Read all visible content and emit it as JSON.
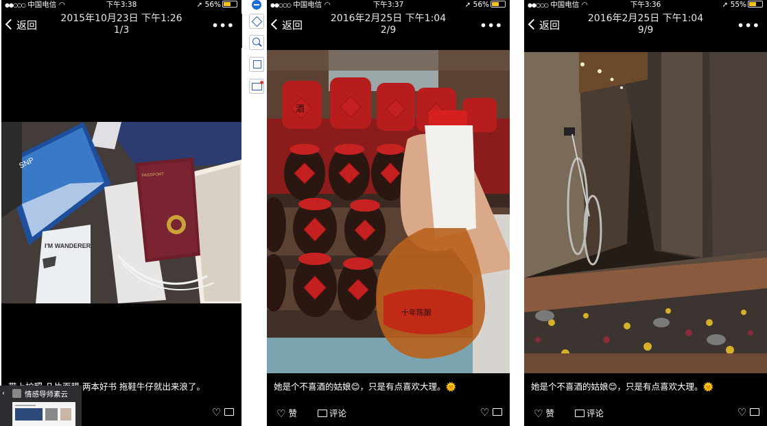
{
  "panels": [
    {
      "status": {
        "carrier": "中国电信",
        "time": "下午3:38",
        "battery": "56%"
      },
      "nav": {
        "back": "返回",
        "date": "2015年10月23日 下午1:26",
        "count": "1/3"
      },
      "caption": "带上护照 几片面膜 两本好书 拖鞋牛仔就出来浪了。",
      "actions": {}
    },
    {
      "status": {
        "carrier": "中国电信",
        "time": "下午3:37",
        "battery": "56%"
      },
      "nav": {
        "back": "返回",
        "date": "2016年2月25日 下午1:04",
        "count": "2/9"
      },
      "caption": "她是个不喜酒的姑娘😊，只是有点喜欢大理。🌞",
      "actions": {
        "like": "赞",
        "comment": "评论"
      }
    },
    {
      "status": {
        "carrier": "中国电信",
        "time": "下午3:36",
        "battery": "55%"
      },
      "nav": {
        "back": "返回",
        "date": "2016年2月25日 下午1:04",
        "count": "9/9"
      },
      "caption": "她是个不喜酒的姑娘😊，只是有点喜欢大理。🌞",
      "actions": {
        "like": "赞",
        "comment": "评论"
      }
    }
  ],
  "photo_text": {
    "mask": "SNP",
    "jar_label": "酒",
    "bottle_label": "十年陈酿",
    "bag_text": "I'M WANDERER",
    "passport": "PASSPORT"
  },
  "taskbar_popup": {
    "title": "情感导师素云"
  },
  "icons": [
    "signal-dots-icon",
    "wifi-icon",
    "location-icon",
    "battery-icon",
    "back-chevron-icon",
    "more-icon",
    "heart-icon",
    "comment-icon",
    "layers-icon",
    "zoom-icon",
    "crop-icon",
    "screenshot-icon"
  ]
}
